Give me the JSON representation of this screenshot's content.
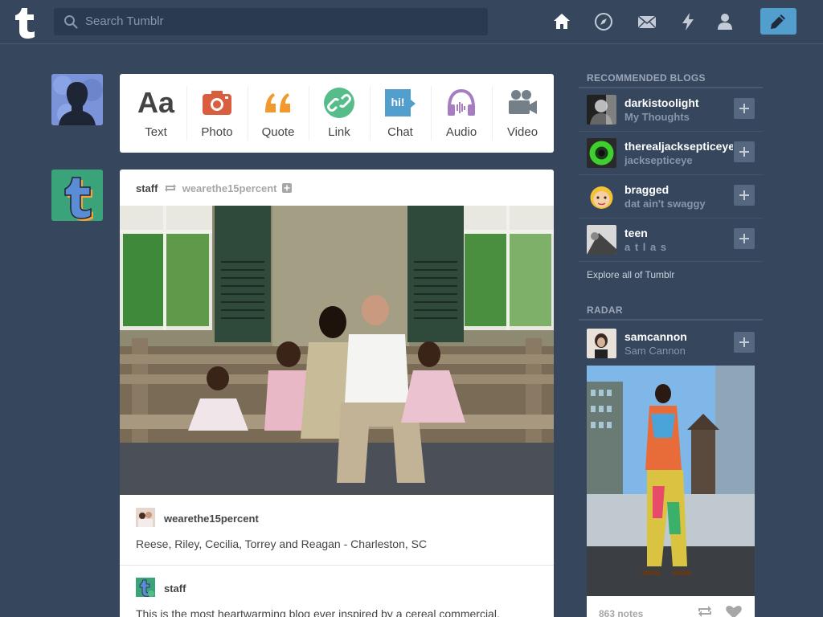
{
  "header": {
    "search_placeholder": "Search Tumblr"
  },
  "post_types": [
    {
      "label": "Text",
      "icon": "text-icon",
      "color": "#444444"
    },
    {
      "label": "Photo",
      "icon": "camera-icon",
      "color": "#d95e40"
    },
    {
      "label": "Quote",
      "icon": "quote-icon",
      "color": "#f2992e"
    },
    {
      "label": "Link",
      "icon": "link-icon",
      "color": "#56bc8a"
    },
    {
      "label": "Chat",
      "icon": "chat-icon",
      "color": "#529ecc"
    },
    {
      "label": "Audio",
      "icon": "headphones-icon",
      "color": "#a77dc2"
    },
    {
      "label": "Video",
      "icon": "video-camera-icon",
      "color": "#748089"
    }
  ],
  "post": {
    "author": "staff",
    "reblogged_from": "wearethe15percent",
    "source_name": "wearethe15percent",
    "caption": "Reese, Riley, Cecilia, Torrey and Reagan - Charleston, SC",
    "second_author": "staff",
    "body_text": "This is the most heartwarming blog ever inspired by a cereal commercial."
  },
  "sidebar": {
    "recommended_title": "RECOMMENDED BLOGS",
    "blogs": [
      {
        "name": "darkistoolight",
        "title": "My Thoughts"
      },
      {
        "name": "therealjacksepticeye",
        "title": "jacksepticeye"
      },
      {
        "name": "bragged",
        "title": "dat ain't swaggy"
      },
      {
        "name": "teen",
        "title": "a t l a s"
      }
    ],
    "explore_label": "Explore all of Tumblr",
    "radar_title": "RADAR",
    "radar": {
      "name": "samcannon",
      "title": "Sam Cannon",
      "notes": "863 notes"
    }
  }
}
